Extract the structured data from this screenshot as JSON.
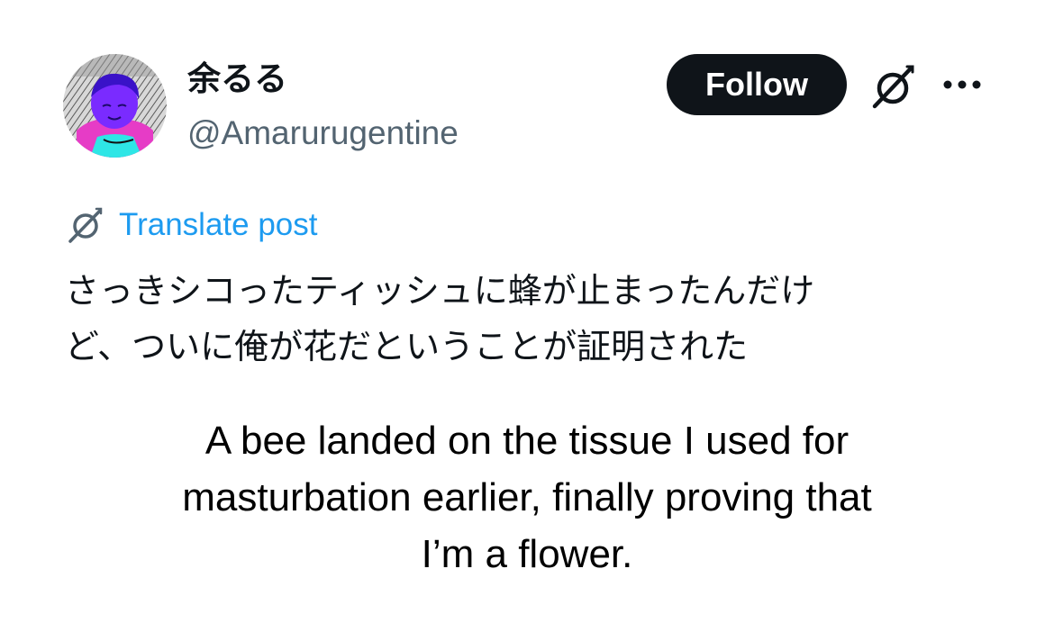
{
  "author": {
    "display_name": "余るる",
    "handle": "@Amarurugentine"
  },
  "actions": {
    "follow_label": "Follow",
    "grok_icon": "grok-slash-icon",
    "more_icon": "more-dots-icon"
  },
  "translate": {
    "label": "Translate post",
    "icon": "grok-slash-icon"
  },
  "post": {
    "lines": [
      "さっきシコったティッシュに蜂が止まったんだけ",
      "ど、ついに俺が花だということが証明された"
    ]
  },
  "caption": {
    "lines": [
      "A bee landed on the tissue I used for",
      "masturbation earlier, finally proving that",
      "I’m a flower."
    ]
  },
  "colors": {
    "text": "#0f1419",
    "secondary": "#536471",
    "link": "#1d9bf0",
    "button_bg": "#0f1419",
    "button_text": "#ffffff"
  }
}
